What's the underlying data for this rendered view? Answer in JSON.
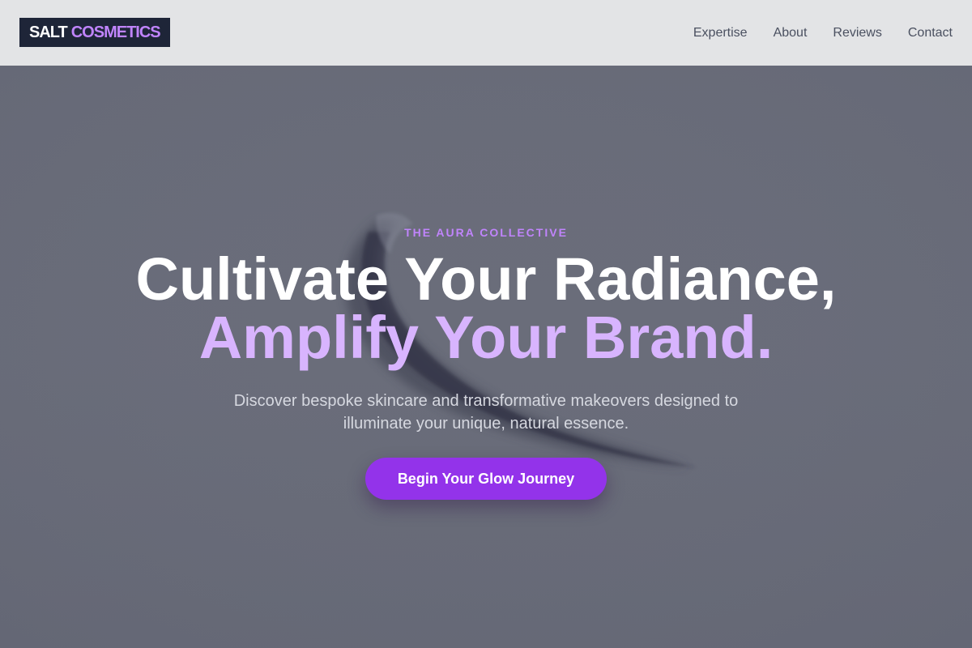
{
  "header": {
    "logo": {
      "word1": "SALT",
      "word2": "COSMETICS"
    },
    "nav": [
      {
        "label": "Expertise"
      },
      {
        "label": "About"
      },
      {
        "label": "Reviews"
      },
      {
        "label": "Contact"
      }
    ]
  },
  "hero": {
    "eyebrow": "THE AURA COLLECTIVE",
    "headline_line1": "Cultivate Your Radiance,",
    "headline_line2": "Amplify Your Brand.",
    "subtitle": "Discover bespoke skincare and transformative makeovers designed to illuminate your unique, natural essence.",
    "cta_label": "Begin Your Glow Journey"
  },
  "colors": {
    "header_bg": "#e3e4e6",
    "logo_bg": "#1e2538",
    "accent": "#9333ea",
    "accent_light": "#d8b4fe",
    "eyebrow": "#c084fc"
  }
}
